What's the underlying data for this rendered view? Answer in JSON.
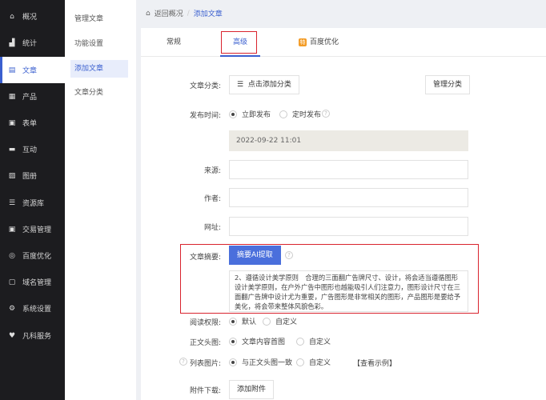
{
  "sidebar": {
    "items": [
      {
        "label": "概况",
        "icon": "home-icon"
      },
      {
        "label": "统计",
        "icon": "stats-icon"
      },
      {
        "label": "文章",
        "icon": "article-icon"
      },
      {
        "label": "产品",
        "icon": "grid-icon"
      },
      {
        "label": "表单",
        "icon": "form-icon"
      },
      {
        "label": "互动",
        "icon": "chat-icon"
      },
      {
        "label": "图册",
        "icon": "album-icon"
      },
      {
        "label": "资源库",
        "icon": "database-icon"
      },
      {
        "label": "交易管理",
        "icon": "trade-icon"
      },
      {
        "label": "百度优化",
        "icon": "baidu-icon"
      },
      {
        "label": "域名管理",
        "icon": "domain-icon"
      },
      {
        "label": "系统设置",
        "icon": "gear-icon"
      },
      {
        "label": "凡科服务",
        "icon": "heart-icon"
      }
    ]
  },
  "submenu": {
    "items": [
      "管理文章",
      "功能设置",
      "添加文章",
      "文章分类"
    ]
  },
  "breadcrumb": {
    "back": "返回概况",
    "sep": "/",
    "current": "添加文章"
  },
  "tabs": {
    "normal": "常规",
    "advanced": "高级",
    "baidu": "百度优化",
    "baidu_badge": "特"
  },
  "form": {
    "category_label": "文章分类:",
    "category_btn": "点击添加分类",
    "manage_category": "管理分类",
    "publish_label": "发布时间:",
    "publish_now": "立即发布",
    "publish_timed": "定时发布",
    "publish_date": "2022-09-22 11:01",
    "source_label": "来源:",
    "author_label": "作者:",
    "url_label": "网址:",
    "summary_label": "文章摘要:",
    "summary_ai_btn": "摘要AI提取",
    "summary_text": "2、遵循设计美学原则　合理的三面翻广告牌尺寸、设计，将会适当遵循图形设计美学原则，在户外广告中图形也越能吸引人们注意力，图形设计尺寸在三面翻广告牌中设计尤为重要，广告图形是非常相关的图形，产品图形是要给予美化，将会带来整体风貌色彩。",
    "read_label": "阅读权限:",
    "read_default": "默认",
    "read_custom": "自定义",
    "head_label": "正文头图:",
    "head_content": "文章内容首图",
    "head_custom": "自定义",
    "list_label": "列表图片:",
    "list_same": "与正文头图一致",
    "list_custom": "自定义",
    "list_example": "【查看示例】",
    "attach_label": "附件下载:",
    "attach_btn": "添加附件"
  },
  "colors": {
    "accent": "#3a5fcf",
    "sidebar": "#1c1c1f",
    "highlight": "#d9232e"
  }
}
